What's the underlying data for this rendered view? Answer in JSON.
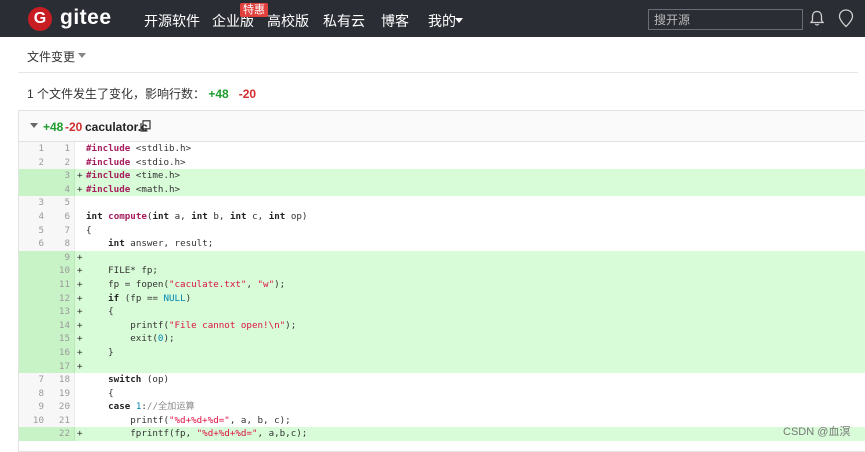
{
  "nav": {
    "brand": "gitee",
    "logo_letter": "G",
    "items": [
      "开源软件",
      "企业版",
      "高校版",
      "私有云",
      "博客",
      "我的"
    ],
    "badge": "特惠",
    "search_placeholder": "搜开源"
  },
  "toolbar": {
    "file_changes_label": "文件变更"
  },
  "summary": {
    "text": "1 个文件发生了变化，影响行数：",
    "added": "+48",
    "removed": "-20"
  },
  "file": {
    "added": "+48",
    "removed": "-20",
    "name": "caculator.c"
  },
  "diff_rows": [
    {
      "old": "1",
      "new": "1",
      "type": "ctx",
      "html": "<span class=\"kw\">#include</span> &lt;stdlib.h&gt;"
    },
    {
      "old": "2",
      "new": "2",
      "type": "ctx",
      "html": "<span class=\"kw\">#include</span> &lt;stdio.h&gt;"
    },
    {
      "old": "",
      "new": "3",
      "type": "add",
      "html": "<span class=\"kw\">#include</span> &lt;time.h&gt;"
    },
    {
      "old": "",
      "new": "4",
      "type": "add",
      "html": "<span class=\"kw\">#include</span> &lt;math.h&gt;"
    },
    {
      "old": "3",
      "new": "5",
      "type": "ctx",
      "html": ""
    },
    {
      "old": "4",
      "new": "6",
      "type": "ctx",
      "html": "<span class=\"kwb\">int</span> <span class=\"fn\">compute</span>(<span class=\"kwb\">int</span> a, <span class=\"kwb\">int</span> b, <span class=\"kwb\">int</span> c, <span class=\"kwb\">int</span> op)"
    },
    {
      "old": "5",
      "new": "7",
      "type": "ctx",
      "html": "{"
    },
    {
      "old": "6",
      "new": "8",
      "type": "ctx",
      "html": "    <span class=\"kwb\">int</span> answer, result;"
    },
    {
      "old": "",
      "new": "9",
      "type": "add",
      "html": ""
    },
    {
      "old": "",
      "new": "10",
      "type": "add",
      "html": "    FILE* fp;"
    },
    {
      "old": "",
      "new": "11",
      "type": "add",
      "html": "    fp = fopen(<span class=\"str\">\"caculate.txt\"</span>, <span class=\"str\">\"w\"</span>);"
    },
    {
      "old": "",
      "new": "12",
      "type": "add",
      "html": "    <span class=\"kwb\">if</span> (fp == <span class=\"num\">NULL</span>)"
    },
    {
      "old": "",
      "new": "13",
      "type": "add",
      "html": "    {"
    },
    {
      "old": "",
      "new": "14",
      "type": "add",
      "html": "        printf(<span class=\"str\">\"File cannot open!\\n\"</span>);"
    },
    {
      "old": "",
      "new": "15",
      "type": "add",
      "html": "        exit(<span class=\"num\">0</span>);"
    },
    {
      "old": "",
      "new": "16",
      "type": "add",
      "html": "    }"
    },
    {
      "old": "",
      "new": "17",
      "type": "add",
      "html": ""
    },
    {
      "old": "7",
      "new": "18",
      "type": "ctx",
      "html": "    <span class=\"kwb\">switch</span> (op)"
    },
    {
      "old": "8",
      "new": "19",
      "type": "ctx",
      "html": "    {"
    },
    {
      "old": "9",
      "new": "20",
      "type": "ctx",
      "html": "    <span class=\"kwb\">case</span> <span class=\"num\">1</span>:<span class=\"cm\">//全加运算</span>"
    },
    {
      "old": "10",
      "new": "21",
      "type": "ctx",
      "html": "        printf(<span class=\"str\">\"%d+%d+%d=\"</span>, a, b, c);"
    },
    {
      "old": "",
      "new": "22",
      "type": "add",
      "html": "        fprintf(fp, <span class=\"str\">\"%d+%d+%d=\"</span>, a,b,c);"
    }
  ],
  "watermark": "CSDN @血溟"
}
